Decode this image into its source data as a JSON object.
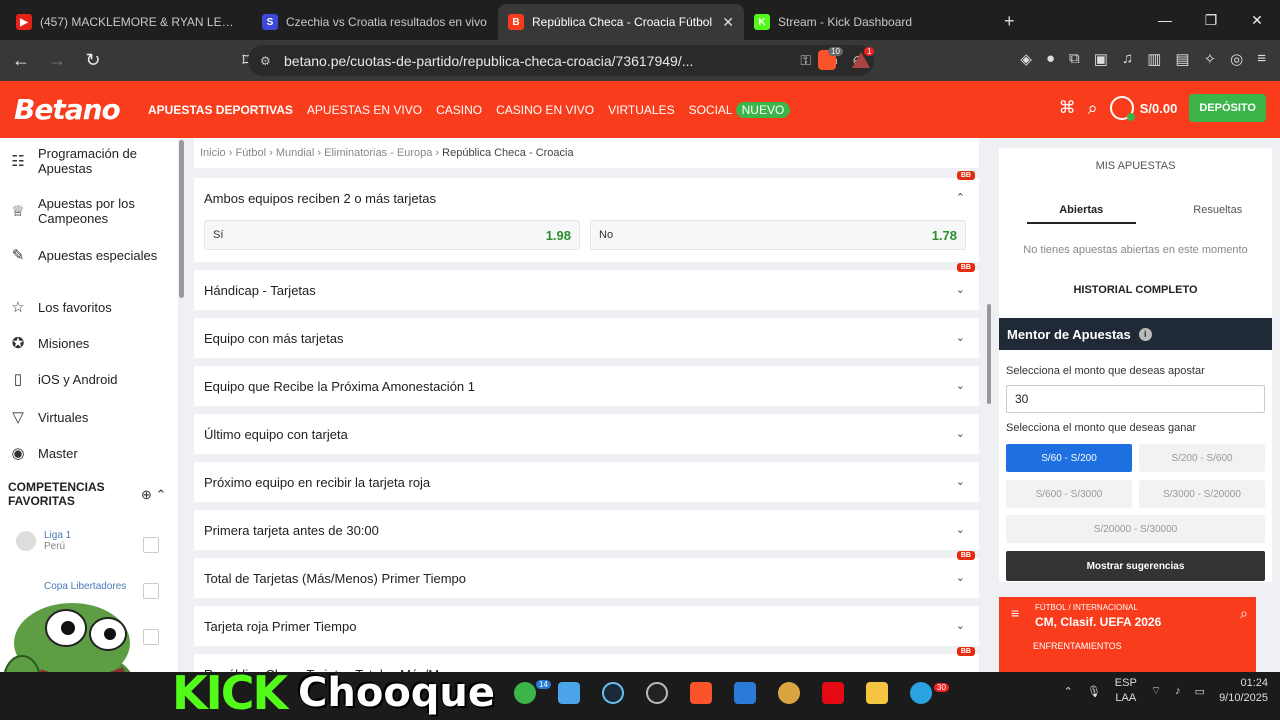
{
  "browser": {
    "tabs": [
      {
        "title": "(457) MACKLEMORE & RYAN LEWIS",
        "color": "#e62117",
        "glyph": "▶",
        "active": false
      },
      {
        "title": "Czechia vs Croatia resultados en vivo",
        "color": "#4048d8",
        "glyph": "S",
        "active": false
      },
      {
        "title": "República Checa - Croacia Fútbol",
        "color": "#f93c1c",
        "glyph": "B",
        "active": true
      },
      {
        "title": "Stream - Kick Dashboard",
        "color": "#53fc18",
        "glyph": "K",
        "active": false
      }
    ],
    "url": "betano.pe/cuotas-de-partido/republica-checa-croacia/73617949/...",
    "brave_count": "10",
    "alert_count": "1"
  },
  "site": {
    "logo": "Betano",
    "nav": [
      "APUESTAS DEPORTIVAS",
      "APUESTAS EN VIVO",
      "CASINO",
      "CASINO EN VIVO",
      "VIRTUALES",
      "SOCIAL"
    ],
    "nuevo": "NUEVO",
    "balance": "S/0.00",
    "deposit": "DEPÓSITO"
  },
  "sidebar": {
    "items": [
      {
        "label": "Programación de Apuestas",
        "icon": "ticket-icon"
      },
      {
        "label": "Apuestas por los Campeones",
        "icon": "trophy-icon"
      },
      {
        "label": "Apuestas especiales",
        "icon": "special-icon"
      },
      {
        "label": "Los favoritos",
        "icon": "star-icon"
      },
      {
        "label": "Misiones",
        "icon": "missions-icon"
      },
      {
        "label": "iOS y Android",
        "icon": "phone-icon"
      },
      {
        "label": "Virtuales",
        "icon": "virtual-icon"
      },
      {
        "label": "Master",
        "icon": "master-icon"
      }
    ],
    "competitions_title": "COMPETENCIAS FAVORITAS",
    "leagues": [
      {
        "name": "Liga 1",
        "country": "Perú"
      },
      {
        "name": "Copa Libertadores",
        "country": ""
      }
    ]
  },
  "breadcrumb": [
    "Inicio",
    "Fútbol",
    "Mundial",
    "Eliminatorias - Europa",
    "República Checa - Croacia"
  ],
  "markets": [
    {
      "title": "Ambos equipos reciben 2 o más tarjetas",
      "bb": true,
      "expanded": true
    },
    {
      "title": "Hándicap - Tarjetas",
      "bb": true
    },
    {
      "title": "Equipo con más tarjetas",
      "bb": false
    },
    {
      "title": "Equipo que Recibe la Próxima Amonestación 1",
      "bb": false
    },
    {
      "title": "Último equipo con tarjeta",
      "bb": false
    },
    {
      "title": "Próximo equipo en recibir la tarjeta roja",
      "bb": false
    },
    {
      "title": "Primera tarjeta antes de 30:00",
      "bb": false
    },
    {
      "title": "Total de Tarjetas (Más/Menos) Primer Tiempo",
      "bb": true
    },
    {
      "title": "Tarjeta roja Primer Tiempo",
      "bb": false
    },
    {
      "title": "República Checa Tarjetas Totales Más/Menos",
      "bb": true
    }
  ],
  "odds": [
    {
      "label": "Sí",
      "value": "1.98"
    },
    {
      "label": "No",
      "value": "1.78"
    }
  ],
  "bb_label": "BB",
  "my_bets": {
    "title": "MIS APUESTAS",
    "tabs": [
      "Abiertas",
      "Resueltas"
    ],
    "empty": "No tienes apuestas abiertas en este momento",
    "history": "HISTORIAL COMPLETO"
  },
  "mentor": {
    "title": "Mentor de Apuestas",
    "stake_label": "Selecciona el monto que deseas apostar",
    "stake_value": "30",
    "win_label": "Selecciona el monto que deseas ganar",
    "ranges": [
      "S/60 - S/200",
      "S/200 - S/600",
      "S/600 - S/3000",
      "S/3000 - S/20000",
      "S/20000 - S/30000"
    ],
    "suggest": "Mostrar sugerencias"
  },
  "live": {
    "category": "FÚTBOL / INTERNACIONAL",
    "match": "CM, Clasif. UEFA 2026",
    "tab": "ENFRENTAMIENTOS"
  },
  "overlay": {
    "kick": "KICK",
    "name": "Chooque"
  },
  "taskbar": {
    "lang1": "ESP",
    "lang2": "LAA",
    "time": "01:24",
    "date": "9/10/2025",
    "badge1": "14",
    "badge2": "30"
  }
}
